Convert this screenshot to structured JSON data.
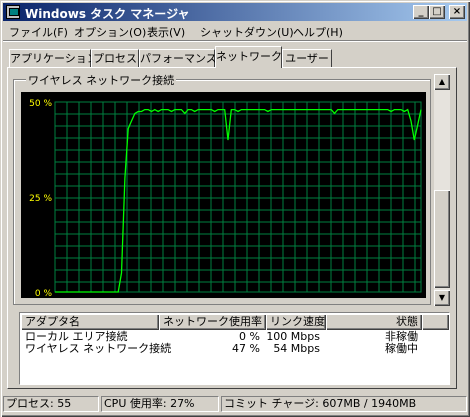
{
  "window": {
    "title": "Windows タスク マネージャ"
  },
  "title_buttons": {
    "minimize": "_",
    "maximize": "□",
    "close": "×"
  },
  "menu": [
    "ファイル(F)",
    "オプション(O)",
    "表示(V)",
    "シャットダウン(U)",
    "ヘルプ(H)"
  ],
  "tabs": [
    "アプリケーション",
    "プロセス",
    "パフォーマンス",
    "ネットワーク",
    "ユーザー"
  ],
  "active_tab": "ネットワーク",
  "graph": {
    "group_title": "ワイヤレス ネットワーク接続",
    "y_labels": [
      "50 %",
      "25 %",
      "0 %"
    ],
    "line_color": "#00ff00",
    "grid_color": "#008040",
    "samples": [
      0,
      0,
      0,
      0,
      0,
      0,
      0,
      0,
      0,
      0,
      0,
      0,
      0,
      0,
      0,
      0,
      0,
      0,
      0,
      0,
      5,
      30,
      43,
      45,
      47,
      47.5,
      47.5,
      48,
      48,
      47.5,
      48,
      47.5,
      48,
      48,
      48,
      47.5,
      48,
      48,
      48,
      47,
      48,
      48,
      47.5,
      48,
      48,
      48,
      48,
      48,
      47.5,
      48,
      48,
      48,
      40,
      48,
      48,
      47.5,
      48,
      48,
      48,
      48,
      48,
      48,
      48,
      48,
      47.5,
      48,
      48,
      48,
      48,
      48,
      48,
      48,
      48,
      48,
      48,
      48,
      48,
      48,
      48,
      48,
      48,
      48,
      48,
      48,
      47,
      48,
      48,
      48,
      48,
      48,
      48,
      48,
      48,
      48,
      48,
      48,
      48,
      48,
      48,
      48,
      48,
      47.5,
      48,
      48,
      48,
      47.5,
      48,
      45,
      40,
      44,
      48
    ]
  },
  "scroll": {
    "up": "▲",
    "down": "▼"
  },
  "adapters": {
    "headers": [
      "アダプタ名",
      "ネットワーク使用率",
      "リンク速度",
      "状態"
    ],
    "rows": [
      {
        "name": "ローカル エリア接続",
        "usage": "0 %",
        "speed": "100 Mbps",
        "status": "非稼働"
      },
      {
        "name": "ワイヤレス ネットワーク接続",
        "usage": "47 %",
        "speed": "54 Mbps",
        "status": "稼働中"
      }
    ]
  },
  "status": {
    "processes": "プロセス: 55",
    "cpu": "CPU 使用率: 27%",
    "commit": "コミット チャージ: 607MB / 1940MB"
  }
}
